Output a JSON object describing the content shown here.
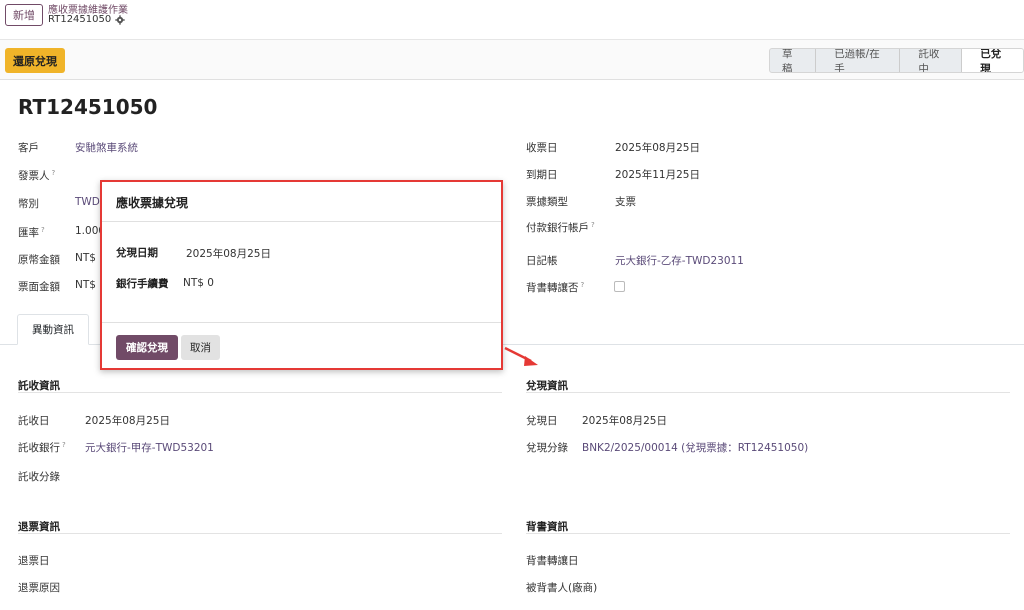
{
  "header": {
    "new_label": "新增",
    "breadcrumb_title": "應收票據維護作業",
    "record_ref": "RT12451050"
  },
  "toolbar": {
    "restore_label": "還原兌現"
  },
  "statusbar": {
    "stages": [
      "草稿",
      "已過帳/在手",
      "託收中",
      "已兌現"
    ],
    "active": "已兌現"
  },
  "record": {
    "title": "RT12451050",
    "left_fields": [
      {
        "label": "客戶",
        "value": "安馳煞車系統",
        "help": false
      },
      {
        "label": "發票人",
        "value": "",
        "help": true
      },
      {
        "label": "幣別",
        "value": "TWD",
        "help": false
      },
      {
        "label": "匯率",
        "value": "1.000",
        "help": true
      },
      {
        "label": "原幣金額",
        "value": "NT$",
        "help": false
      },
      {
        "label": "票面金額",
        "value": "NT$",
        "help": false
      }
    ],
    "right_fields": [
      {
        "label": "收票日",
        "value": "2025年08月25日",
        "help": false
      },
      {
        "label": "到期日",
        "value": "2025年11月25日",
        "help": false
      },
      {
        "label": "票據類型",
        "value": "支票",
        "help": false
      },
      {
        "label": "付款銀行帳戶",
        "value": "",
        "help": true
      },
      {
        "label": "日記帳",
        "value": "元大銀行-乙存-TWD23011",
        "help": false
      },
      {
        "label": "背書轉讓否",
        "value": "",
        "help": true
      }
    ]
  },
  "tabs": {
    "active": "異動資訊"
  },
  "sections": {
    "collection": {
      "title": "託收資訊",
      "fields": [
        {
          "label": "託收日",
          "value": "2025年08月25日",
          "help": false
        },
        {
          "label": "託收銀行",
          "value": "元大銀行-甲存-TWD53201",
          "help": true
        },
        {
          "label": "託收分錄",
          "value": "",
          "help": false
        }
      ]
    },
    "cashing": {
      "title": "兌現資訊",
      "fields": [
        {
          "label": "兌現日",
          "value": "2025年08月25日"
        },
        {
          "label": "兌現分錄",
          "value": "BNK2/2025/00014 (兌現票據：RT12451050)"
        }
      ]
    },
    "return": {
      "title": "退票資訊",
      "fields": [
        {
          "label": "退票日",
          "value": ""
        },
        {
          "label": "退票原因",
          "value": ""
        }
      ]
    },
    "endorse": {
      "title": "背書資訊",
      "fields": [
        {
          "label": "背書轉讓日",
          "value": ""
        },
        {
          "label": "被背書人(廠商)",
          "value": ""
        }
      ]
    }
  },
  "modal": {
    "title": "應收票據兌現",
    "date_label": "兌現日期",
    "date_value": "2025年08月25日",
    "fee_label": "銀行手續費",
    "fee_value": "NT$ 0",
    "confirm_label": "確認兌現",
    "cancel_label": "取消"
  },
  "colors": {
    "brand": "#714b67",
    "warning": "#f0b429",
    "highlight": "#e53935"
  }
}
